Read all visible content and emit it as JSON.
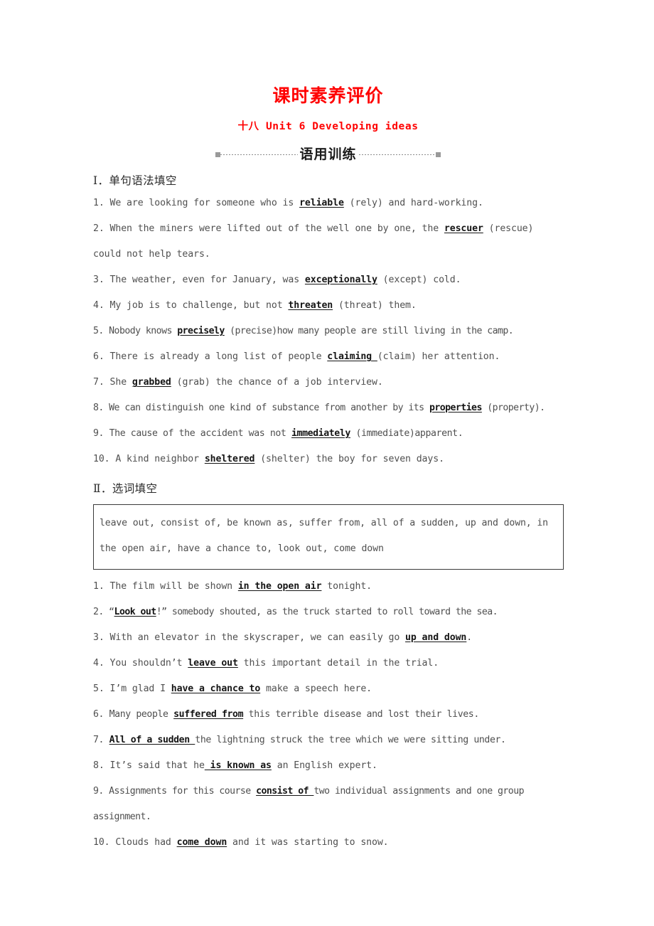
{
  "document": {
    "title": "课时素养评价",
    "subtitle": "十八  Unit 6  Developing ideas",
    "ribbon_label": "语用训练",
    "title_color": "#ff0000",
    "ribbon_color": "#1b1b1b"
  },
  "section1": {
    "heading": "Ⅰ．单句语法填空",
    "items": [
      {
        "number": "1.",
        "before": " We are looking for someone who is ",
        "answer": "reliable",
        "after": " (rely) and hard-working."
      },
      {
        "number": "2.",
        "before": " When the miners were lifted out of the well one by one, the ",
        "answer": "rescuer",
        "after": " (rescue) could not help tears."
      },
      {
        "number": "3.",
        "before": " The weather, even for January, was ",
        "answer": "exceptionally",
        "after": " (except) cold."
      },
      {
        "number": "4.",
        "before": " My job is to challenge, but not ",
        "answer": "threaten",
        "after": " (threat) them."
      },
      {
        "number": "5.",
        "before": " Nobody knows ",
        "answer": "precisely",
        "after": " (precise)how many people are still living in the camp."
      },
      {
        "number": "6.",
        "before": " There is already a long list of people ",
        "answer": "claiming ",
        "after": "(claim) her attention."
      },
      {
        "number": "7.",
        "before": " She ",
        "answer": "grabbed",
        "after": " (grab) the chance of a job interview."
      },
      {
        "number": "8.",
        "before": " We can distinguish one kind of substance from another by its ",
        "answer": "properties",
        "after": " (property)."
      },
      {
        "number": "9.",
        "before": " The cause of the accident was not ",
        "answer": "immediately",
        "after": " (immediate)apparent."
      },
      {
        "number": "10.",
        "before": " A kind neighbor ",
        "answer": "sheltered",
        "after": " (shelter) the boy for seven days."
      }
    ]
  },
  "section2": {
    "heading": "Ⅱ．选词填空",
    "wordbank_line1": "leave out, consist of, be known as, suffer from, all of a sudden, up and down, in",
    "wordbank_line2": "the open air, have a chance to, look out, come down",
    "items": [
      {
        "number": "1.",
        "before": " The film will be shown ",
        "answer": "in the open air",
        "after": " tonight."
      },
      {
        "number": "2.",
        "before": " “",
        "answer": "Look out",
        "after": "!” somebody shouted, as the truck started to roll toward the sea."
      },
      {
        "number": "3.",
        "before": " With an elevator in the skyscraper, we can easily go ",
        "answer": "up and down",
        "after": "."
      },
      {
        "number": "4.",
        "before": " You shouldn’t ",
        "answer": "leave out",
        "after": " this important detail in the trial."
      },
      {
        "number": "5.",
        "before": " I’m glad I ",
        "answer": "have a chance to",
        "after": " make a speech here."
      },
      {
        "number": "6.",
        "before": " Many people ",
        "answer": "suffered from",
        "after": " this terrible disease and lost their lives."
      },
      {
        "number": "7.",
        "before": " ",
        "answer": "All of a sudden ",
        "after": "the lightning struck the tree which we were sitting under."
      },
      {
        "number": "8.",
        "before": " It’s said that he",
        "answer": " is known as",
        "after": " an English expert."
      },
      {
        "number": "9.",
        "before": " Assignments for this course ",
        "answer": "consist of ",
        "after": "two individual assignments and one group assignment."
      },
      {
        "number": "10.",
        "before": " Clouds had ",
        "answer": "come down",
        "after": " and it was starting to snow."
      }
    ]
  }
}
